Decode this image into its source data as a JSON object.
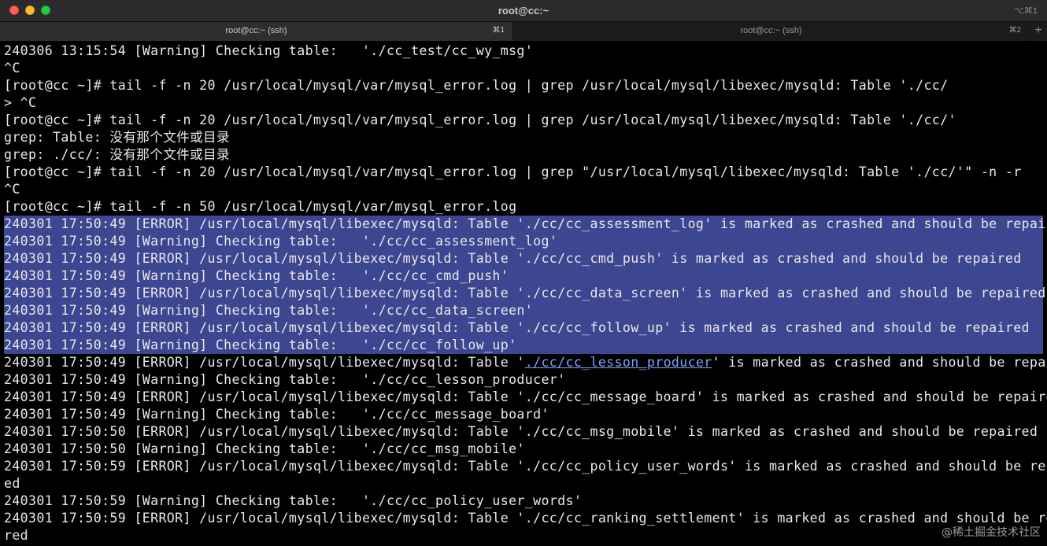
{
  "window": {
    "title": "root@cc:~",
    "shortcut": "⌥⌘1"
  },
  "tabs": [
    {
      "label": "root@cc:~ (ssh)",
      "shortcut": "⌘1"
    },
    {
      "label": "root@cc:~ (ssh)",
      "shortcut": "⌘2"
    }
  ],
  "tab_add_label": "+",
  "terminal": {
    "lines": [
      "240306 13:15:54 [Warning] Checking table:   './cc_test/cc_wy_msg'",
      "^C",
      "[root@cc ~]# tail -f -n 20 /usr/local/mysql/var/mysql_error.log | grep /usr/local/mysql/libexec/mysqld: Table './cc/",
      "> ^C",
      "[root@cc ~]# tail -f -n 20 /usr/local/mysql/var/mysql_error.log | grep /usr/local/mysql/libexec/mysqld: Table './cc/'",
      "grep: Table: 没有那个文件或目录",
      "grep: ./cc/: 没有那个文件或目录",
      "[root@cc ~]# tail -f -n 20 /usr/local/mysql/var/mysql_error.log | grep \"/usr/local/mysql/libexec/mysqld: Table './cc/'\" -n -r",
      "^C",
      "[root@cc ~]# tail -f -n 50 /usr/local/mysql/var/mysql_error.log",
      "240301 17:50:49 [ERROR] /usr/local/mysql/libexec/mysqld: Table './cc/cc_assessment_log' is marked as crashed and should be repaired",
      "240301 17:50:49 [Warning] Checking table:   './cc/cc_assessment_log'",
      "240301 17:50:49 [ERROR] /usr/local/mysql/libexec/mysqld: Table './cc/cc_cmd_push' is marked as crashed and should be repaired",
      "240301 17:50:49 [Warning] Checking table:   './cc/cc_cmd_push'",
      "240301 17:50:49 [ERROR] /usr/local/mysql/libexec/mysqld: Table './cc/cc_data_screen' is marked as crashed and should be repaired",
      "240301 17:50:49 [Warning] Checking table:   './cc/cc_data_screen'",
      "240301 17:50:49 [ERROR] /usr/local/mysql/libexec/mysqld: Table './cc/cc_follow_up' is marked as crashed and should be repaired",
      "240301 17:50:49 [Warning] Checking table:   './cc/cc_follow_up'",
      "",
      "240301 17:50:49 [Warning] Checking table:   './cc/cc_lesson_producer'",
      "240301 17:50:49 [ERROR] /usr/local/mysql/libexec/mysqld: Table './cc/cc_message_board' is marked as crashed and should be repaired",
      "240301 17:50:49 [Warning] Checking table:   './cc/cc_message_board'",
      "240301 17:50:50 [ERROR] /usr/local/mysql/libexec/mysqld: Table './cc/cc_msg_mobile' is marked as crashed and should be repaired",
      "240301 17:50:50 [Warning] Checking table:   './cc/cc_msg_mobile'",
      "240301 17:50:59 [ERROR] /usr/local/mysql/libexec/mysqld: Table './cc/cc_policy_user_words' is marked as crashed and should be repair",
      "ed",
      "240301 17:50:59 [Warning] Checking table:   './cc/cc_policy_user_words'",
      "240301 17:50:59 [ERROR] /usr/local/mysql/libexec/mysqld: Table './cc/cc_ranking_settlement' is marked as crashed and should be repai",
      "red"
    ],
    "link_line": {
      "before": "240301 17:50:49 [ERROR] /usr/local/mysql/libexec/mysqld: Table '",
      "link": "./cc/cc_lesson_producer",
      "after": "' is marked as crashed and should be repaired"
    }
  },
  "watermark": "@稀土掘金技术社区"
}
